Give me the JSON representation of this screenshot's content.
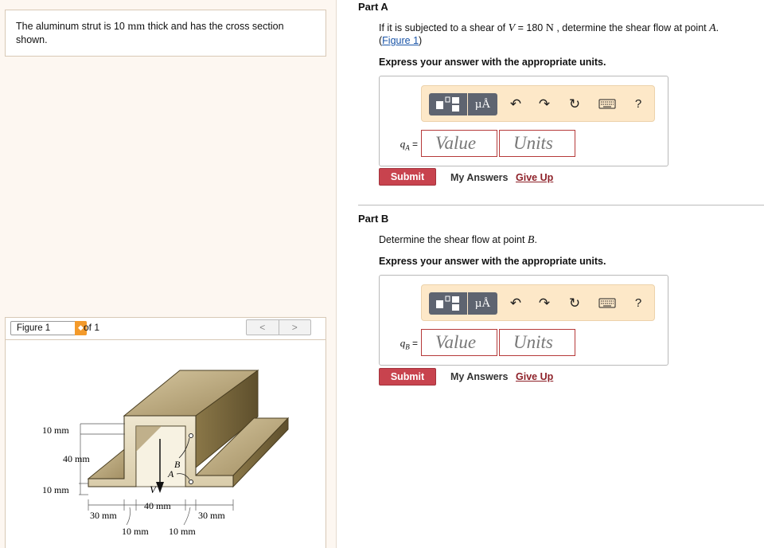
{
  "problem": {
    "text_before": "The aluminum strut is 10 ",
    "unit_mm": "mm",
    "text_after": " thick and has the cross section shown."
  },
  "figure_nav": {
    "select_value": "Figure 1",
    "of_text": "of 1",
    "prev_glyph": "<",
    "next_glyph": ">"
  },
  "figure": {
    "dim_10mm_top": "10 mm",
    "dim_40mm_left": "40 mm",
    "dim_10mm_bottom": "10 mm",
    "dim_40mm_mid": "40 mm",
    "dim_30mm_left": "30 mm",
    "dim_30mm_right": "30 mm",
    "dim_10mm_a": "10 mm",
    "dim_10mm_b": "10 mm",
    "label_v": "V",
    "label_a": "A",
    "label_b": "B"
  },
  "part_a": {
    "title": "Part A",
    "q_pre": "If it is subjected to a shear of ",
    "q_var": "V",
    "q_mid": " = 180 ",
    "q_unit": "N",
    "q_post": " , determine the shear flow at point ",
    "q_point": "A",
    "q_end": ".",
    "link_open": "(",
    "figure_link": "Figure 1",
    "link_close": ")",
    "express": "Express your answer with the appropriate units.",
    "var_letter": "q",
    "var_sub": "A",
    "equals": "=",
    "value_placeholder": "Value",
    "units_placeholder": "Units",
    "submit": "Submit",
    "my_answers": "My Answers",
    "give_up": "Give Up"
  },
  "part_b": {
    "title": "Part B",
    "q_pre": "Determine the shear flow at point ",
    "q_point": "B",
    "q_end": ".",
    "express": "Express your answer with the appropriate units.",
    "var_letter": "q",
    "var_sub": "B",
    "equals": "=",
    "value_placeholder": "Value",
    "units_placeholder": "Units",
    "submit": "Submit",
    "my_answers": "My Answers",
    "give_up": "Give Up"
  },
  "toolbar": {
    "units_glyph": "µÅ",
    "undo_glyph": "↶",
    "redo_glyph": "↷",
    "reset_glyph": "↻",
    "help_glyph": "?"
  },
  "icons": {
    "templates": "templates-icon",
    "units": "units-icon",
    "undo": "undo-icon",
    "redo": "redo-icon",
    "reset": "reset-icon",
    "keyboard": "keyboard-icon",
    "help": "help-icon"
  },
  "colors": {
    "submit": "#c8434e",
    "give_up": "#8e2129",
    "toolbar_bg": "#fde8c8",
    "field_border": "#b63a3a",
    "left_panel_bg": "#fdf7f1",
    "select_accent": "#f39a2b"
  }
}
